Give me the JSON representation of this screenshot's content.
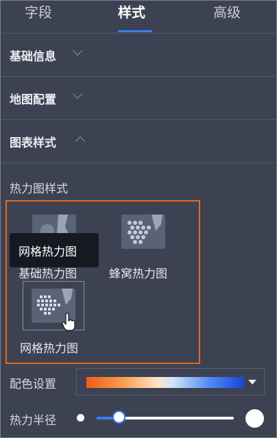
{
  "tabs": [
    {
      "label": "字段"
    },
    {
      "label": "样式"
    },
    {
      "label": "高级"
    }
  ],
  "active_tab": 1,
  "sections": [
    {
      "label": "基础信息",
      "expanded": false
    },
    {
      "label": "地图配置",
      "expanded": false
    },
    {
      "label": "图表样式",
      "expanded": true
    }
  ],
  "heatmap_style": {
    "label": "热力图样式",
    "options": [
      {
        "label": "基础热力图",
        "icon": "basic-heatmap-thumbnail"
      },
      {
        "label": "蜂窝热力图",
        "icon": "honeycomb-heatmap-thumbnail"
      },
      {
        "label": "网格热力图",
        "icon": "grid-heatmap-thumbnail"
      }
    ],
    "selected_index": 2,
    "tooltip": "网格热力图"
  },
  "color_setting": {
    "label": "配色设置",
    "gradient": [
      "#f35b1a",
      "#fde4c4",
      "#1b43dc"
    ]
  },
  "heat_radius": {
    "label": "热力半径",
    "value_fraction": 0.16
  },
  "colors": {
    "accent": "#3a7cf6",
    "selection": "#e66b1c"
  }
}
